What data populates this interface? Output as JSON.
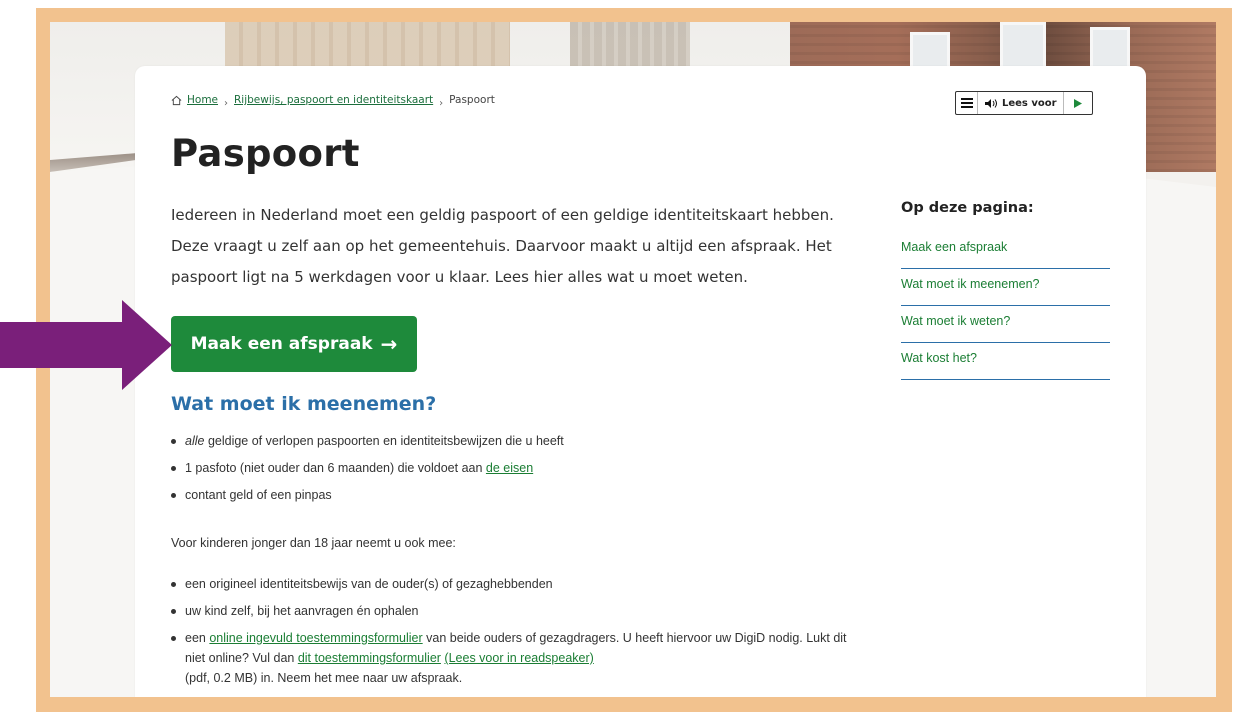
{
  "breadcrumb": {
    "home": "Home",
    "section": "Rijbewijs, paspoort en identiteitskaart",
    "current": "Paspoort",
    "separator": "›"
  },
  "readspeaker": {
    "menu_icon": "hamburger-icon",
    "label": "Lees voor",
    "play_icon": "play-icon"
  },
  "page": {
    "title": "Paspoort",
    "intro": "Iedereen in Nederland moet een geldig paspoort of een geldige identiteitskaart hebben. Deze vraagt u zelf aan op het gemeentehuis. Daarvoor maakt u altijd een afspraak. Het paspoort ligt na 5 werkdagen voor u klaar. Lees hier alles wat u moet weten.",
    "cta_label": "Maak een afspraak",
    "cta_arrow": "→"
  },
  "section": {
    "heading": "Wat moet ik meenemen?",
    "items": [
      {
        "emph": "alle",
        "text": " geldige of verlopen paspoorten en identiteitsbewijzen die u heeft"
      },
      {
        "text": "1 pasfoto (niet ouder dan 6 maanden) die voldoet aan ",
        "link": "de eisen"
      },
      {
        "text": "contant geld of een pinpas"
      }
    ],
    "children_intro": "Voor kinderen jonger dan 18 jaar neemt u ook mee:",
    "children_items": [
      {
        "text": "een origineel identiteitsbewijs van de ouder(s) of gezaghebbenden"
      },
      {
        "text": "uw kind zelf, bij het aanvragen én ophalen"
      },
      {
        "pre": "een ",
        "link1": "online ingevuld toestemmingsformulier",
        "mid": " van beide ouders of gezagdragers. U heeft hiervoor uw DigiD nodig. Lukt dit niet online? Vul dan ",
        "link2": "dit toestemmingsformulier",
        "link3": "(Lees voor in readspeaker)",
        "post": "(pdf, 0.2 MB)  in. Neem het mee naar uw afspraak."
      }
    ]
  },
  "toc": {
    "title": "Op deze pagina:",
    "items": [
      "Maak een afspraak",
      "Wat moet ik meenemen?",
      "Wat moet ik weten?",
      "Wat kost het?"
    ]
  },
  "colors": {
    "accent_green": "#1e8a3b",
    "heading_blue": "#2b6fa8",
    "frame": "#f2c28e",
    "arrow_purple": "#7a1f7a"
  }
}
